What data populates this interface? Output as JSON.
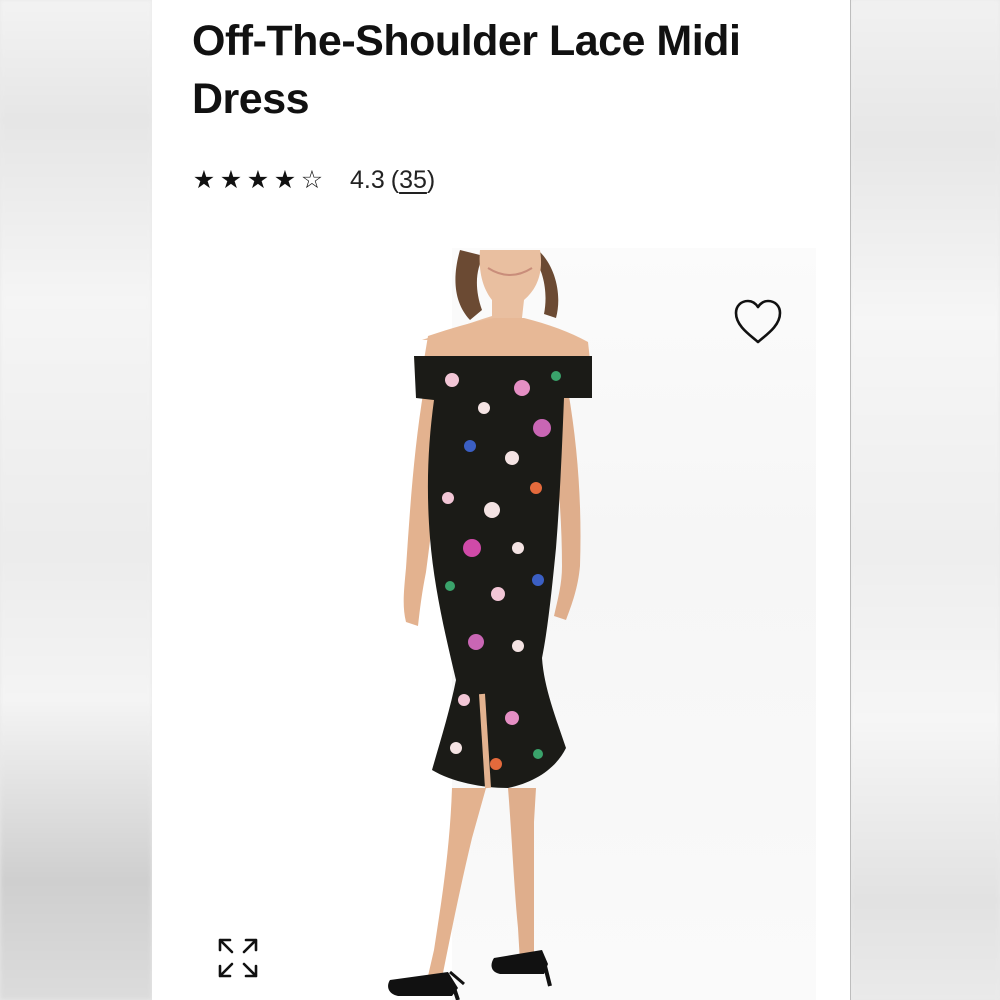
{
  "product": {
    "title": "Off-The-Shoulder Lace Midi Dress",
    "rating": {
      "stars": [
        "★",
        "★",
        "★",
        "★",
        "☆"
      ],
      "value": "4.3",
      "count_open": "(",
      "count": "35",
      "count_close": ")"
    }
  },
  "image": {
    "alt": "Model wearing black floral lace off-the-shoulder midi dress with flounce hem and black strappy heels",
    "icons": {
      "wishlist": "heart-outline-icon",
      "expand": "expand-arrows-icon"
    }
  }
}
